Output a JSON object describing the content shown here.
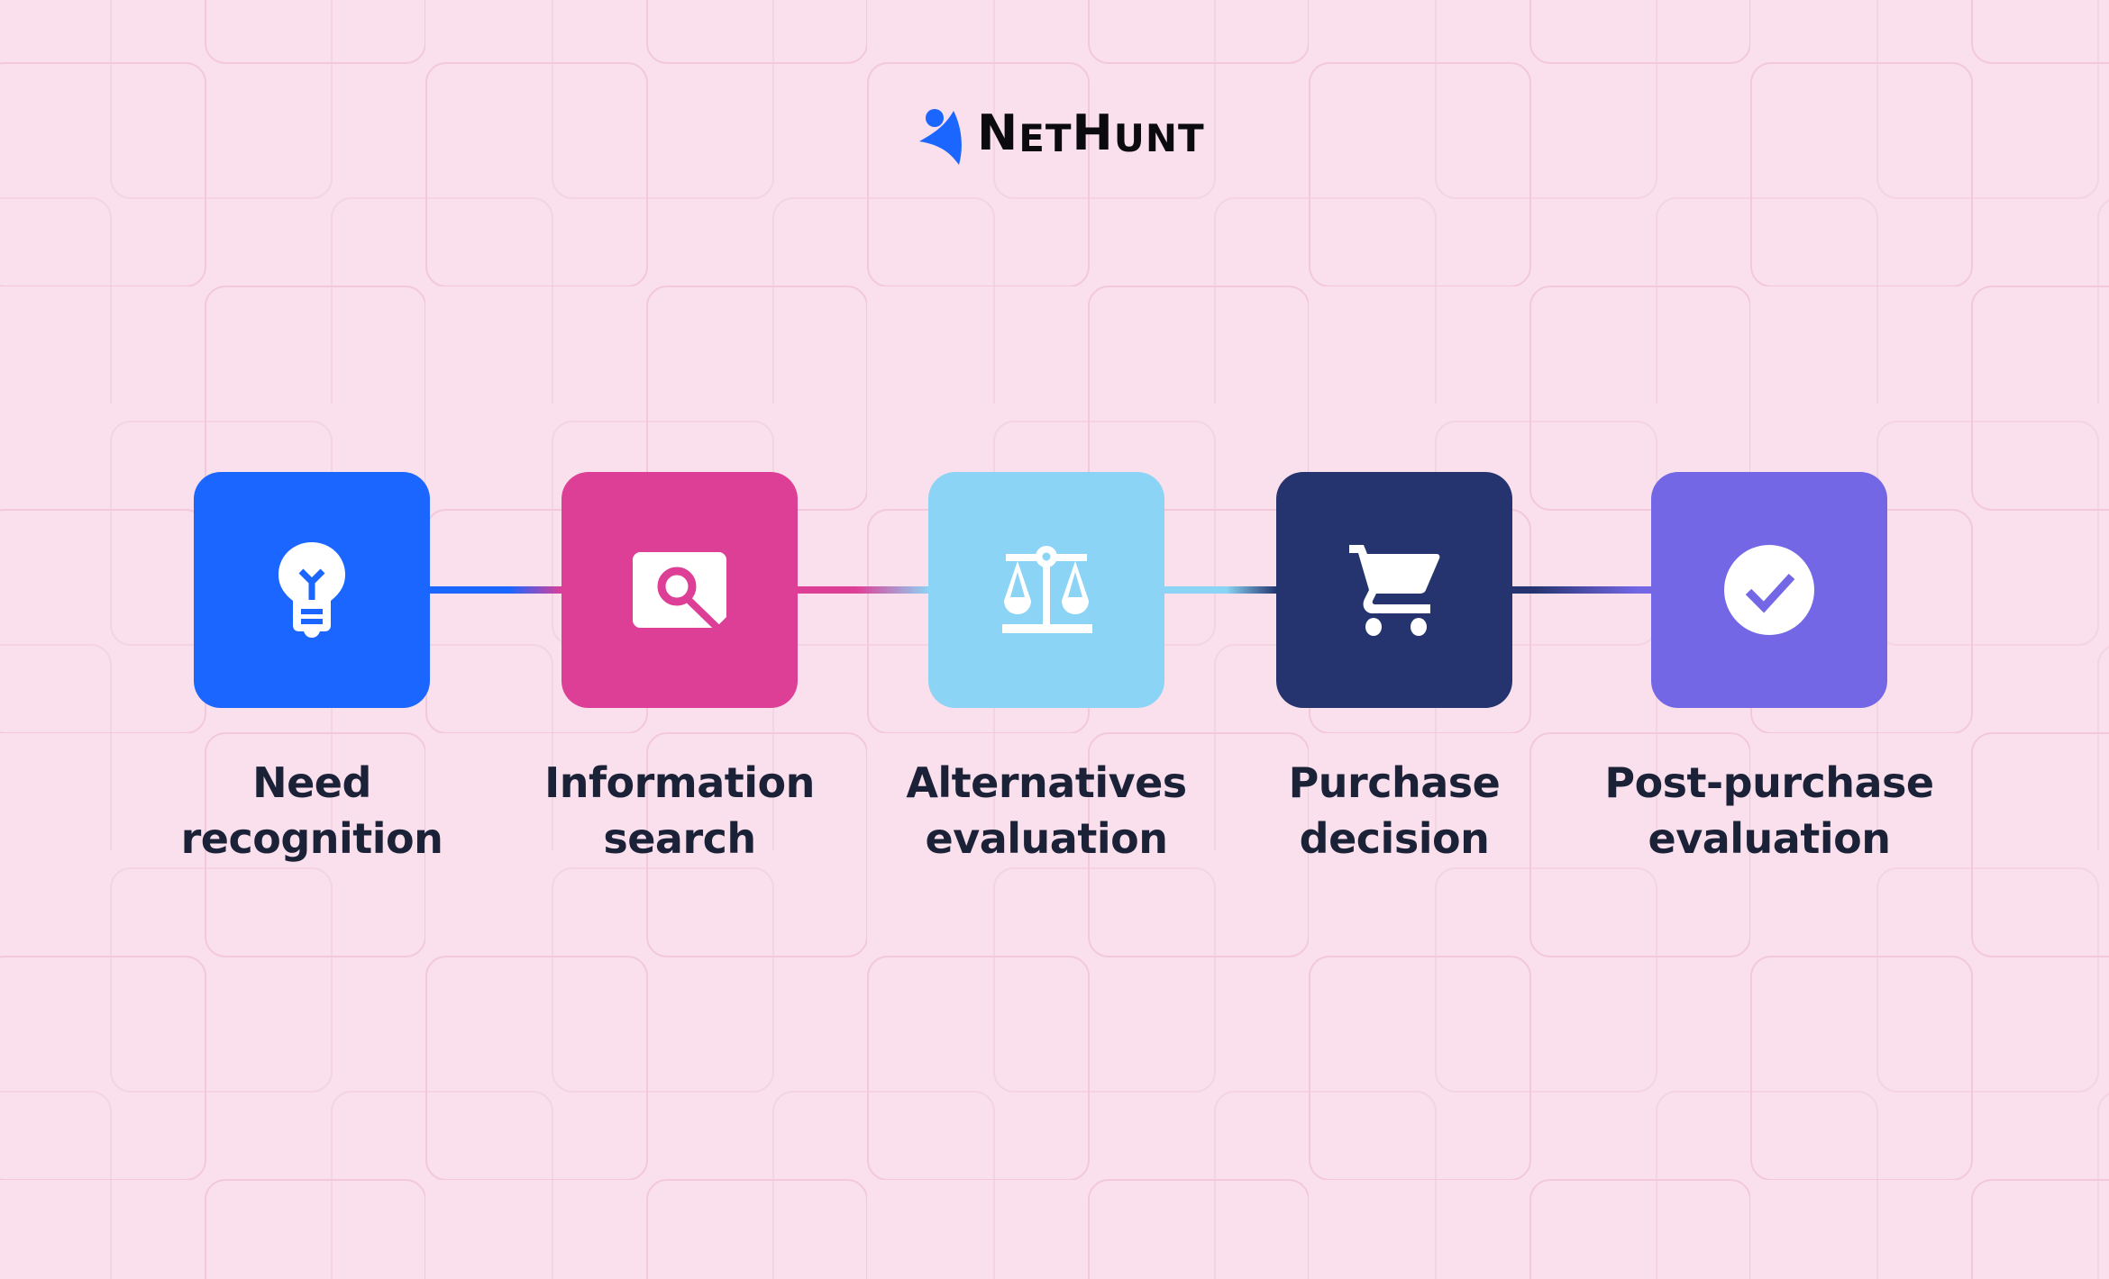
{
  "brand": {
    "name_parts": [
      {
        "text": "N",
        "size": "big"
      },
      {
        "text": "ET",
        "size": "small"
      },
      {
        "text": "H",
        "size": "big"
      },
      {
        "text": "UNT",
        "size": "small"
      }
    ],
    "name": "NetHunt",
    "logo_color": "#1a66ff",
    "text_color": "#0b0b0f"
  },
  "background": {
    "color": "#f9e0ec",
    "pattern_stroke": "#f3c6d9"
  },
  "steps": [
    {
      "id": "need-recognition",
      "lines": [
        "Need",
        "recognition"
      ],
      "icon": "lightbulb-icon",
      "color": "#1a66ff"
    },
    {
      "id": "information-search",
      "lines": [
        "Information",
        "search"
      ],
      "icon": "search-icon",
      "color": "#de3f96"
    },
    {
      "id": "alternatives-evaluation",
      "lines": [
        "Alternatives",
        "evaluation"
      ],
      "icon": "scale-icon",
      "color": "#8cd4f5"
    },
    {
      "id": "purchase-decision",
      "lines": [
        "Purchase",
        "decision"
      ],
      "icon": "cart-icon",
      "color": "#25346e"
    },
    {
      "id": "post-purchase-evaluation",
      "lines": [
        "Post-purchase",
        "evaluation"
      ],
      "icon": "check-circle-icon",
      "color": "#7467e6"
    }
  ],
  "label_color": "#1b2238"
}
